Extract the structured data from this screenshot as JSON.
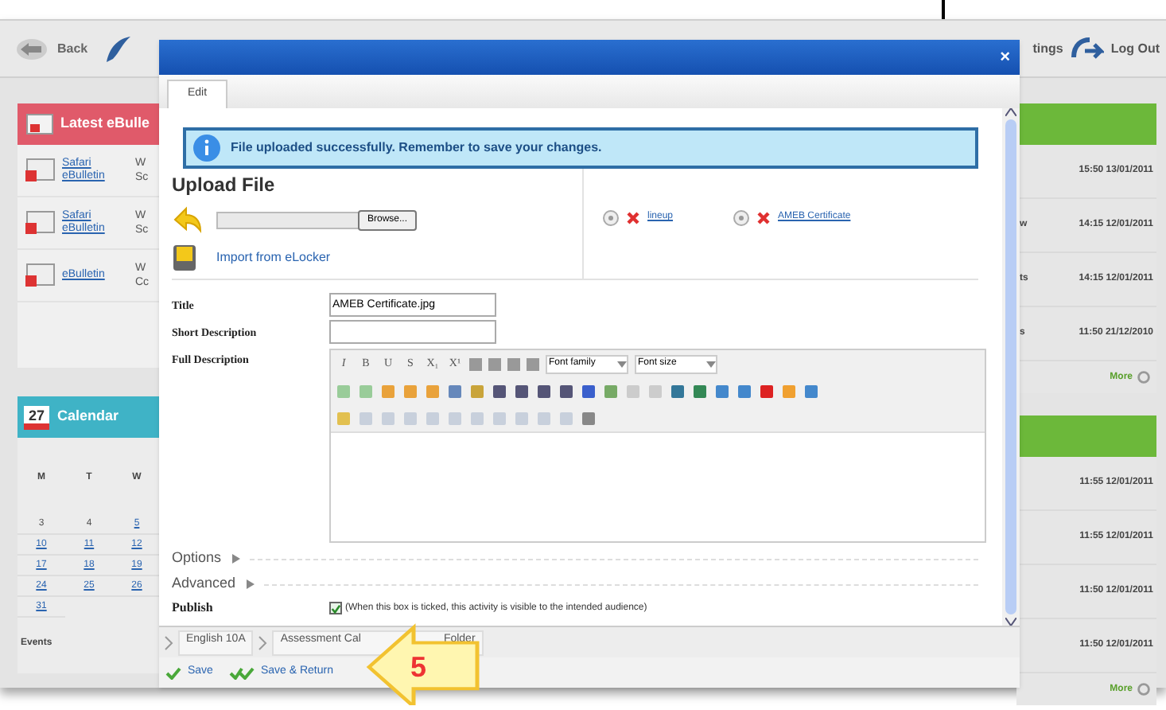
{
  "top_bar": {
    "back": "Back",
    "right_partial": "tings",
    "logout": "Log Out"
  },
  "bulletins": {
    "title": "Latest eBulle",
    "rows": [
      {
        "link": "Safari eBulletin",
        "column_2": [
          "W",
          "Sc"
        ]
      },
      {
        "link": "Safari eBulletin",
        "column_2": [
          "W",
          "Sc"
        ]
      },
      {
        "link": "eBulletin",
        "column_2": [
          "W",
          "Cc"
        ]
      }
    ]
  },
  "calendar": {
    "icon_day": "27",
    "title": "Calendar",
    "weekdays": [
      "M",
      "T",
      "W"
    ],
    "weeks": [
      [
        {
          "day": "3",
          "linked": false
        },
        {
          "day": "4",
          "linked": false
        },
        {
          "day": "5",
          "linked": true
        }
      ],
      [
        {
          "day": "10",
          "linked": true
        },
        {
          "day": "11",
          "linked": true
        },
        {
          "day": "12",
          "linked": true
        }
      ],
      [
        {
          "day": "17",
          "linked": true
        },
        {
          "day": "18",
          "linked": true
        },
        {
          "day": "19",
          "linked": true
        }
      ],
      [
        {
          "day": "24",
          "linked": true
        },
        {
          "day": "25",
          "linked": true
        },
        {
          "day": "26",
          "linked": true
        }
      ],
      [
        {
          "day": "31",
          "linked": true
        }
      ]
    ],
    "footer": "Events"
  },
  "activity_panels": [
    {
      "rows": [
        {
          "partial": "",
          "time": "15:50 13/01/2011"
        },
        {
          "partial": "w",
          "time": "14:15 12/01/2011"
        },
        {
          "partial": "ts",
          "time": "14:15 12/01/2011"
        },
        {
          "partial": "s",
          "time": "11:50 21/12/2010"
        }
      ],
      "more": "More"
    },
    {
      "rows": [
        {
          "partial": "",
          "time": "11:55 12/01/2011"
        },
        {
          "partial": "",
          "time": "11:55 12/01/2011"
        },
        {
          "partial": "",
          "time": "11:50 12/01/2011"
        },
        {
          "partial": "",
          "time": "11:50 12/01/2011"
        }
      ],
      "more": "More"
    }
  ],
  "modal": {
    "close": "×",
    "tabs": [
      {
        "label": "Edit",
        "selected": true
      }
    ],
    "notice": "File uploaded successfully. Remember to save your changes.",
    "upload": {
      "heading": "Upload File",
      "browse": "Browse...",
      "import": "Import from eLocker",
      "files": [
        "lineup",
        "AMEB Certificate"
      ]
    },
    "form": {
      "title_label": "Title",
      "title_value": "AMEB Certificate.jpg",
      "short_label": "Short Description",
      "full_label": "Full Description"
    },
    "editor": {
      "text_buttons": [
        "I",
        "B",
        "U",
        "S",
        "X₁",
        "X¹"
      ],
      "font_family": "Font family",
      "font_size": "Font size"
    },
    "sections": [
      {
        "label": "Options",
        "expanded": false
      },
      {
        "label": "Advanced",
        "expanded": false
      }
    ],
    "publish": {
      "label": "Publish",
      "checked": true,
      "note": "(When this box is ticked, this activity is visible to the intended audience)"
    },
    "breadcrumbs": [
      {
        "label": "English 10A"
      },
      {
        "label": "Assessment Cal",
        "tail": "Folder"
      }
    ],
    "actions": [
      {
        "label": "Save",
        "kind": "save"
      },
      {
        "label": "Save & Return",
        "kind": "return"
      }
    ],
    "callout": "5"
  }
}
